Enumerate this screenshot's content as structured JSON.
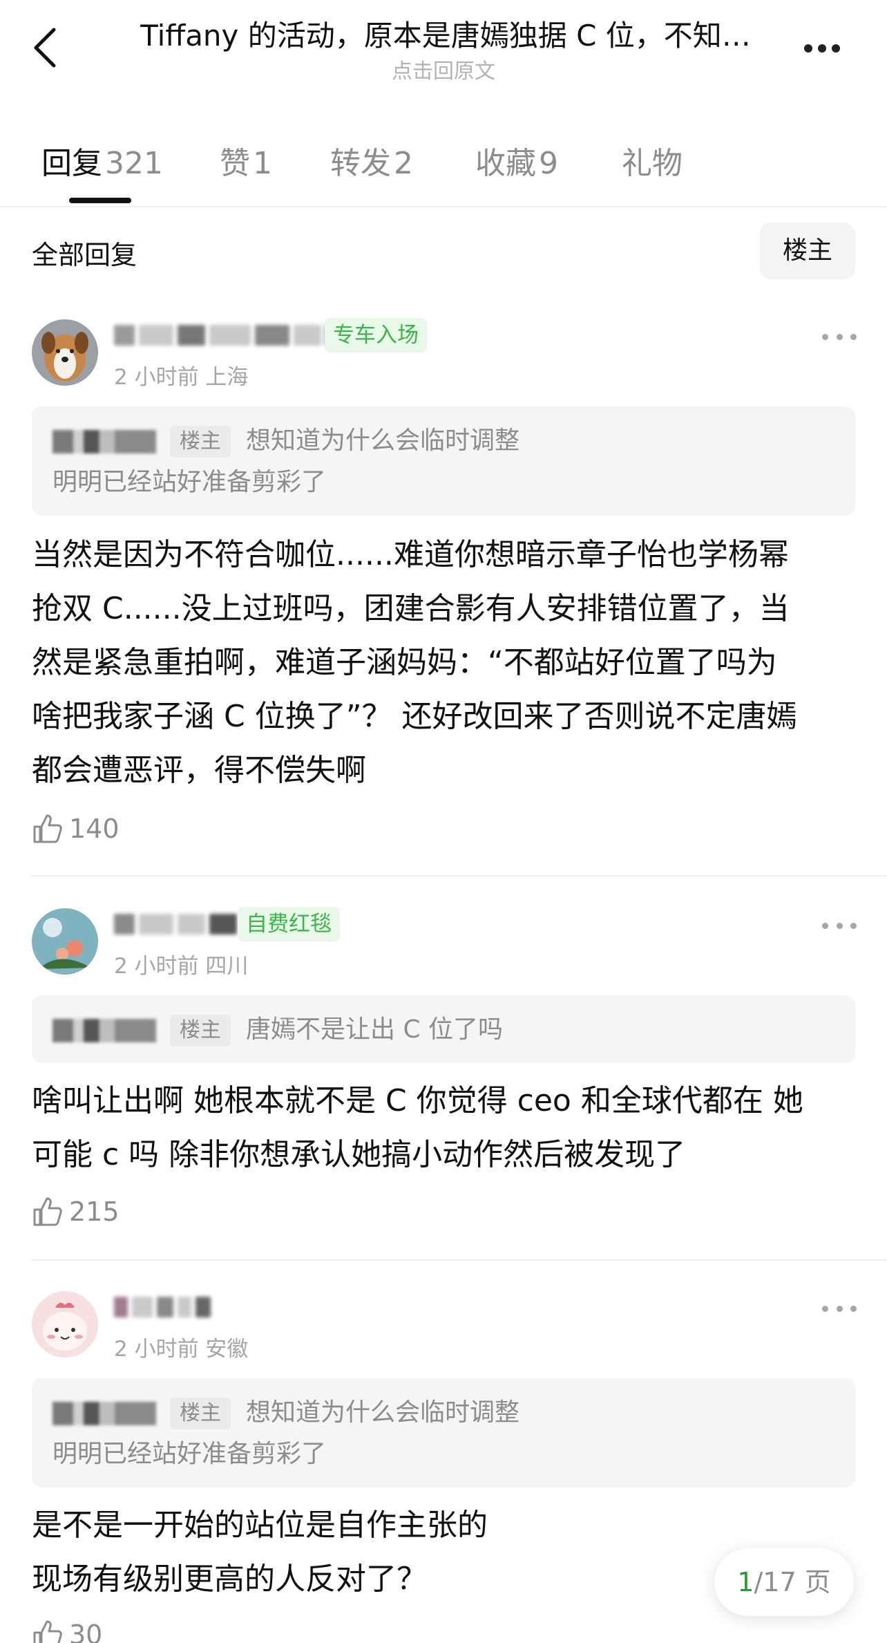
{
  "header": {
    "title": "Tiffany 的活动，原本是唐嫣独据 C 位，不知…",
    "subtitle": "点击回原文"
  },
  "tabs": [
    {
      "label": "回复",
      "count": "321"
    },
    {
      "label": "赞",
      "count": "1"
    },
    {
      "label": "转发",
      "count": "2"
    },
    {
      "label": "收藏",
      "count": "9"
    },
    {
      "label": "礼物",
      "count": ""
    }
  ],
  "filter": {
    "section_title": "全部回复",
    "op_only_label": "楼主"
  },
  "comments": [
    {
      "badge": "专车入场",
      "meta": "2 小时前  上海",
      "quote_op_tag": "楼主",
      "quote_line1": "想知道为什么会临时调整",
      "quote_line2": "明明已经站好准备剪彩了",
      "lines": [
        "当然是因为不符合咖位......难道你想暗示章子怡也学杨幂",
        "抢双 C......没上过班吗，团建合影有人安排错位置了，当",
        "然是紧急重拍啊，难道子涵妈妈：“不都站好位置了吗为",
        "啥把我家子涵 C 位换了”？ 还好改回来了否则说不定唐嫣",
        "都会遭恶评，得不偿失啊"
      ],
      "likes": "140"
    },
    {
      "badge": "自费红毯",
      "meta": "2 小时前  四川",
      "quote_op_tag": "楼主",
      "quote_line1": "唐嫣不是让出 C 位了吗",
      "lines": [
        "啥叫让出啊 她根本就不是 C 你觉得 ceo 和全球代都在 她",
        "可能 c 吗 除非你想承认她搞小动作然后被发现了"
      ],
      "likes": "215"
    },
    {
      "meta": "2 小时前  安徽",
      "quote_op_tag": "楼主",
      "quote_line1": "想知道为什么会临时调整",
      "quote_line2": "明明已经站好准备剪彩了",
      "lines": [
        "是不是一开始的站位是自作主张的",
        "现场有级别更高的人反对了？"
      ],
      "likes": "30"
    }
  ],
  "pager": {
    "current": "1",
    "total_text": "/17 页"
  },
  "colors": {
    "accent_green": "#3cb44b",
    "badge_bg": "#eaf8ea",
    "muted": "#8c8c8c"
  }
}
